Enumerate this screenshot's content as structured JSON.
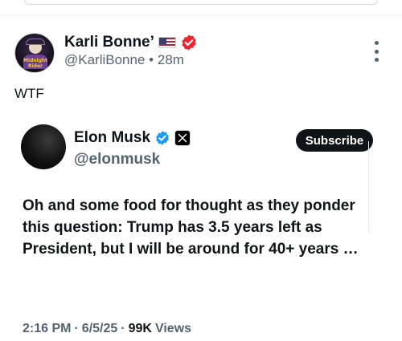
{
  "post": {
    "author": {
      "name": "Karli Bonne’",
      "handle": "@KarliBonne",
      "time": "28m",
      "separator": "•",
      "avatar_text": "Midnight Rider"
    },
    "text": "WTF",
    "quoted": {
      "author": {
        "name": "Elon Musk",
        "handle": "@elonmusk"
      },
      "subscribe_label": "Subscribe",
      "body": "Oh and some food for thought as they ponder this question: Trump has 3.5 years left as President, but I will be around for 40+ years …",
      "meta": {
        "time": "2:16 PM",
        "dot1": "·",
        "date": "6/5/25",
        "dot2": "·",
        "views_count": "99K",
        "views_label": "Views"
      }
    }
  },
  "colors": {
    "text": "#0f1419",
    "secondary": "#536471",
    "verified_blue": "#1d9bf0",
    "badge_red": "#f4212e",
    "subscribe_bg": "#0f1419"
  },
  "icons": {
    "more": "more-vertical-icon",
    "flag": "us-flag-icon",
    "badge": "red-check-badge-icon",
    "verified": "verified-badge-icon",
    "x": "x-logo-icon"
  }
}
